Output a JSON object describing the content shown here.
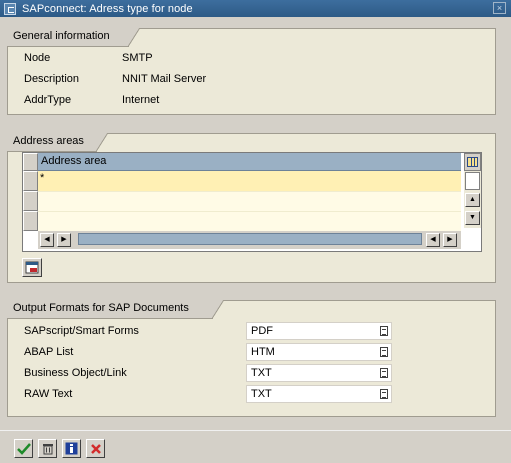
{
  "window": {
    "title": "SAPconnect: Adress type for node",
    "close_glyph": "×"
  },
  "general": {
    "title": "General information",
    "fields": [
      {
        "label": "Node",
        "value": "SMTP"
      },
      {
        "label": "Description",
        "value": "NNIT Mail Server"
      },
      {
        "label": "AddrType",
        "value": "Internet"
      }
    ]
  },
  "address_areas": {
    "title": "Address areas",
    "column_header": "Address area",
    "rows": [
      "*",
      "",
      ""
    ],
    "colors": {
      "selected_row": "#fff0b4",
      "header": "#9ab0c4"
    }
  },
  "output_formats": {
    "title": "Output Formats for SAP Documents",
    "fields": [
      {
        "label": "SAPscript/Smart Forms",
        "value": "PDF"
      },
      {
        "label": "ABAP List",
        "value": "HTM"
      },
      {
        "label": "Business Object/Link",
        "value": "TXT"
      },
      {
        "label": "RAW Text",
        "value": "TXT"
      }
    ]
  },
  "footer": {
    "buttons": [
      "check-icon",
      "delete-icon",
      "info-icon",
      "cancel-icon"
    ]
  }
}
